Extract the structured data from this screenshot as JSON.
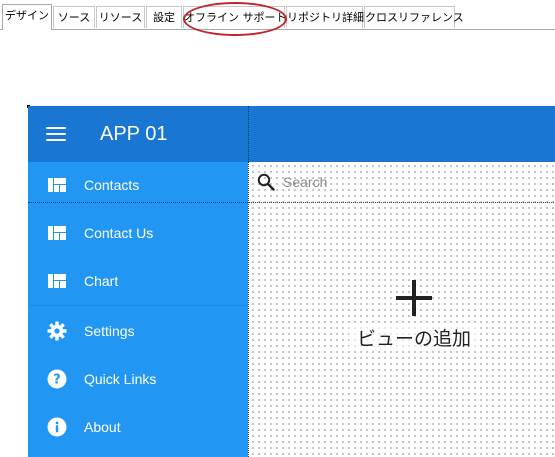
{
  "tabs": [
    {
      "label": "デザイン",
      "active": true
    },
    {
      "label": "ソース",
      "active": false
    },
    {
      "label": "リソース",
      "active": false
    },
    {
      "label": "設定",
      "active": false
    },
    {
      "label": "オフライン サポート",
      "active": false,
      "highlighted": true
    },
    {
      "label": "リポジトリ詳細",
      "active": false
    },
    {
      "label": "クロスリファレンス",
      "active": false
    }
  ],
  "annotation": {
    "color": "#c0252b",
    "target": "オフライン サポート"
  },
  "app": {
    "title": "APP 01",
    "menu_icon": "hamburger-icon",
    "colors": {
      "appbar": "#1976d2",
      "sidebar": "#2196f3",
      "text": "#ffffff"
    }
  },
  "sidebar": {
    "items": [
      {
        "label": "Contacts",
        "icon": "view-dashboard-icon"
      },
      {
        "label": "Contact Us",
        "icon": "view-dashboard-icon"
      },
      {
        "label": "Chart",
        "icon": "view-dashboard-icon"
      },
      {
        "label": "Settings",
        "icon": "gear-icon"
      },
      {
        "label": "Quick Links",
        "icon": "help-circle-icon"
      },
      {
        "label": "About",
        "icon": "info-circle-icon"
      }
    ]
  },
  "search": {
    "placeholder": "Search",
    "value": "",
    "icon": "search-icon"
  },
  "content": {
    "add_view_label": "ビューの追加",
    "add_icon": "plus-icon"
  }
}
